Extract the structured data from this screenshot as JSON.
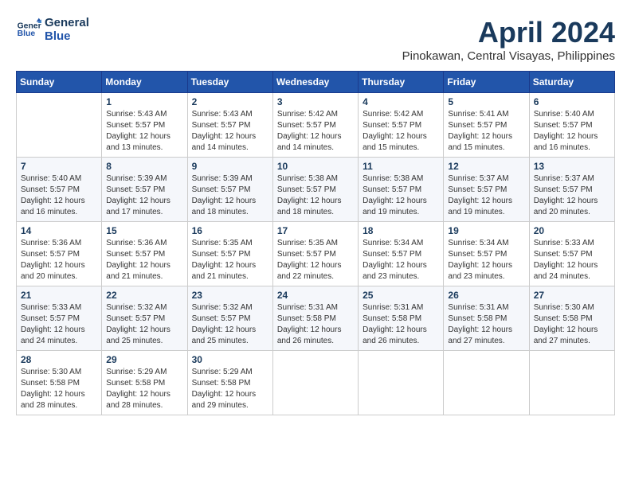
{
  "header": {
    "logo_line1": "General",
    "logo_line2": "Blue",
    "month": "April 2024",
    "location": "Pinokawan, Central Visayas, Philippines"
  },
  "weekdays": [
    "Sunday",
    "Monday",
    "Tuesday",
    "Wednesday",
    "Thursday",
    "Friday",
    "Saturday"
  ],
  "weeks": [
    [
      {
        "day": "",
        "info": ""
      },
      {
        "day": "1",
        "info": "Sunrise: 5:43 AM\nSunset: 5:57 PM\nDaylight: 12 hours\nand 13 minutes."
      },
      {
        "day": "2",
        "info": "Sunrise: 5:43 AM\nSunset: 5:57 PM\nDaylight: 12 hours\nand 14 minutes."
      },
      {
        "day": "3",
        "info": "Sunrise: 5:42 AM\nSunset: 5:57 PM\nDaylight: 12 hours\nand 14 minutes."
      },
      {
        "day": "4",
        "info": "Sunrise: 5:42 AM\nSunset: 5:57 PM\nDaylight: 12 hours\nand 15 minutes."
      },
      {
        "day": "5",
        "info": "Sunrise: 5:41 AM\nSunset: 5:57 PM\nDaylight: 12 hours\nand 15 minutes."
      },
      {
        "day": "6",
        "info": "Sunrise: 5:40 AM\nSunset: 5:57 PM\nDaylight: 12 hours\nand 16 minutes."
      }
    ],
    [
      {
        "day": "7",
        "info": "Sunrise: 5:40 AM\nSunset: 5:57 PM\nDaylight: 12 hours\nand 16 minutes."
      },
      {
        "day": "8",
        "info": "Sunrise: 5:39 AM\nSunset: 5:57 PM\nDaylight: 12 hours\nand 17 minutes."
      },
      {
        "day": "9",
        "info": "Sunrise: 5:39 AM\nSunset: 5:57 PM\nDaylight: 12 hours\nand 18 minutes."
      },
      {
        "day": "10",
        "info": "Sunrise: 5:38 AM\nSunset: 5:57 PM\nDaylight: 12 hours\nand 18 minutes."
      },
      {
        "day": "11",
        "info": "Sunrise: 5:38 AM\nSunset: 5:57 PM\nDaylight: 12 hours\nand 19 minutes."
      },
      {
        "day": "12",
        "info": "Sunrise: 5:37 AM\nSunset: 5:57 PM\nDaylight: 12 hours\nand 19 minutes."
      },
      {
        "day": "13",
        "info": "Sunrise: 5:37 AM\nSunset: 5:57 PM\nDaylight: 12 hours\nand 20 minutes."
      }
    ],
    [
      {
        "day": "14",
        "info": "Sunrise: 5:36 AM\nSunset: 5:57 PM\nDaylight: 12 hours\nand 20 minutes."
      },
      {
        "day": "15",
        "info": "Sunrise: 5:36 AM\nSunset: 5:57 PM\nDaylight: 12 hours\nand 21 minutes."
      },
      {
        "day": "16",
        "info": "Sunrise: 5:35 AM\nSunset: 5:57 PM\nDaylight: 12 hours\nand 21 minutes."
      },
      {
        "day": "17",
        "info": "Sunrise: 5:35 AM\nSunset: 5:57 PM\nDaylight: 12 hours\nand 22 minutes."
      },
      {
        "day": "18",
        "info": "Sunrise: 5:34 AM\nSunset: 5:57 PM\nDaylight: 12 hours\nand 23 minutes."
      },
      {
        "day": "19",
        "info": "Sunrise: 5:34 AM\nSunset: 5:57 PM\nDaylight: 12 hours\nand 23 minutes."
      },
      {
        "day": "20",
        "info": "Sunrise: 5:33 AM\nSunset: 5:57 PM\nDaylight: 12 hours\nand 24 minutes."
      }
    ],
    [
      {
        "day": "21",
        "info": "Sunrise: 5:33 AM\nSunset: 5:57 PM\nDaylight: 12 hours\nand 24 minutes."
      },
      {
        "day": "22",
        "info": "Sunrise: 5:32 AM\nSunset: 5:57 PM\nDaylight: 12 hours\nand 25 minutes."
      },
      {
        "day": "23",
        "info": "Sunrise: 5:32 AM\nSunset: 5:57 PM\nDaylight: 12 hours\nand 25 minutes."
      },
      {
        "day": "24",
        "info": "Sunrise: 5:31 AM\nSunset: 5:58 PM\nDaylight: 12 hours\nand 26 minutes."
      },
      {
        "day": "25",
        "info": "Sunrise: 5:31 AM\nSunset: 5:58 PM\nDaylight: 12 hours\nand 26 minutes."
      },
      {
        "day": "26",
        "info": "Sunrise: 5:31 AM\nSunset: 5:58 PM\nDaylight: 12 hours\nand 27 minutes."
      },
      {
        "day": "27",
        "info": "Sunrise: 5:30 AM\nSunset: 5:58 PM\nDaylight: 12 hours\nand 27 minutes."
      }
    ],
    [
      {
        "day": "28",
        "info": "Sunrise: 5:30 AM\nSunset: 5:58 PM\nDaylight: 12 hours\nand 28 minutes."
      },
      {
        "day": "29",
        "info": "Sunrise: 5:29 AM\nSunset: 5:58 PM\nDaylight: 12 hours\nand 28 minutes."
      },
      {
        "day": "30",
        "info": "Sunrise: 5:29 AM\nSunset: 5:58 PM\nDaylight: 12 hours\nand 29 minutes."
      },
      {
        "day": "",
        "info": ""
      },
      {
        "day": "",
        "info": ""
      },
      {
        "day": "",
        "info": ""
      },
      {
        "day": "",
        "info": ""
      }
    ]
  ]
}
